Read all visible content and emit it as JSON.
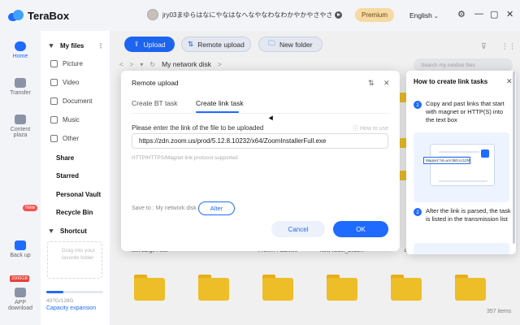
{
  "app": {
    "name": "TeraBox"
  },
  "header": {
    "username": "jry03まゆらはなにやなはなへなやなわなわかやかやさやさ",
    "premium_label": "Premium",
    "language": "English",
    "language_chevron": "⌄",
    "settings_icon": "⚙",
    "minimize_icon": "—",
    "maximize_icon": "▢",
    "close_icon": "✕"
  },
  "nav": {
    "home": "Home",
    "transfer": "Transfer",
    "content_line1": "Content",
    "content_line2": "plaza",
    "backup": "Back up",
    "new_badge": "New",
    "storage_badge": "2000GB",
    "app_line1": "APP",
    "app_line2": "download"
  },
  "sidebar": {
    "my_files": "My files",
    "dots": "⋮",
    "picture": "Picture",
    "video": "Video",
    "document": "Document",
    "music": "Music",
    "other": "Other",
    "share": "Share",
    "starred": "Starred",
    "personal_vault": "Personal Vault",
    "recycle_bin": "Recycle Bin",
    "shortcut": "Shortcut",
    "shortcut_hint": "Drag into your favorite folder",
    "storage_used": "40?G/128G",
    "storage_used_fraction": 0.3,
    "capacity_expansion": "Capacity expansion"
  },
  "toolbar": {
    "upload": "Upload",
    "remote_upload": "Remote upload",
    "new_folder": "New folder",
    "upload_icon": "⇪",
    "remote_icon": "⇅",
    "folder_icon": "🗀",
    "filter_icon": "⊽",
    "grid_icon": "⋮⋮"
  },
  "breadcrumb": {
    "back": "<",
    "forward": ">",
    "dropdown": "▾",
    "refresh": "↻",
    "path": "My network disk",
    "sep": ">"
  },
  "search": {
    "placeholder": "Search my netdisk files"
  },
  "files": {
    "labels": [
      "test Large Files",
      "",
      "Prom... PEDM00",
      "New folder_2022...",
      "cf",
      "asdasdfgfg"
    ],
    "count": "357 items"
  },
  "modal": {
    "title": "Remote upload",
    "resize_icon": "⇅",
    "close_icon": "✕",
    "tab_bt": "Create BT task",
    "tab_link": "Create link task",
    "prompt": "Please enter the link of the file to be uploaded",
    "howto_link": "How to use",
    "howto_icon": "ⓘ",
    "url_value": "https://zdn.zoom.us/prod/5.12.8.10232/x64/ZoomInstallerFull.exe",
    "hint": "HTTP/HTTPS/Magnet link protocol supported",
    "save_to": "Save to : My network disk",
    "alter": "Alter",
    "cancel": "Cancel",
    "ok": "OK"
  },
  "help": {
    "title": "How to create link tasks",
    "close_icon": "✕",
    "step1_num": "1",
    "step1_text": "Copy and past links that start with magnet or HTTP(S) into the text box",
    "illus_text": "Magnet:?xt=urn:btih:cc12f41c06bba",
    "step2_num": "2",
    "step2_text": "After the link is parsed, the task is listed in the transmission list"
  }
}
